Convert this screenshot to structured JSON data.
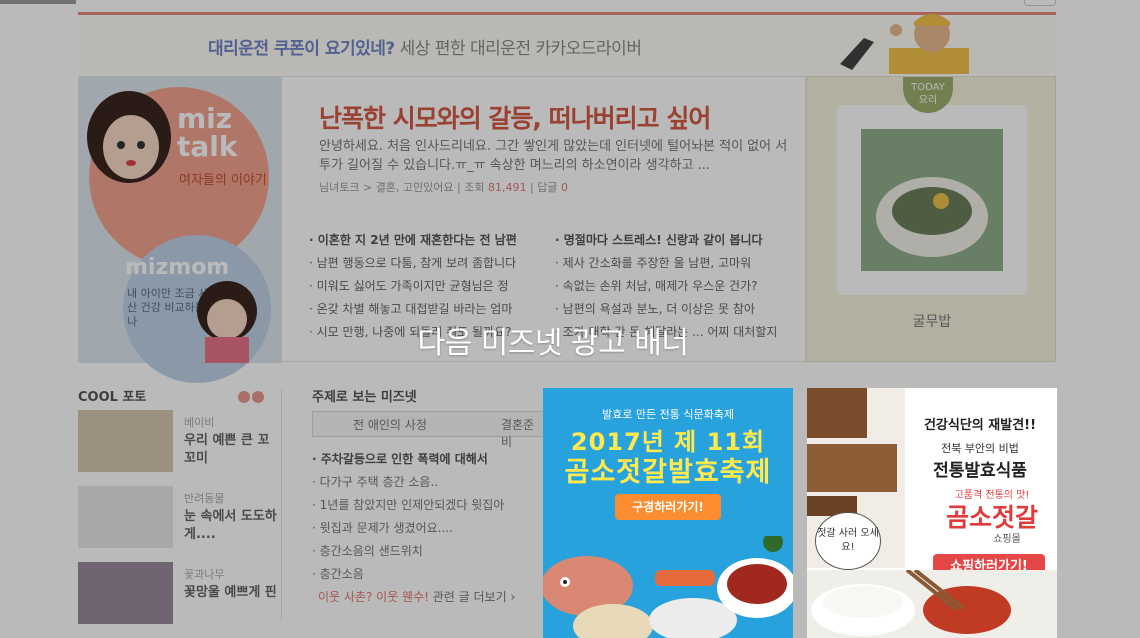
{
  "background_page": {
    "kakao_banner": {
      "highlight": "대리운전 쿠폰이 요기있네?",
      "rest": " 세상 편한 대리운전 카카오드라이버"
    },
    "miztalk": {
      "brand": "miz talk",
      "brand_sub": "여자들의 이야기",
      "mom_brand": "mizmom",
      "mom_sub": "내 아이만 조금 사산 건강 비교하는 나"
    },
    "feature": {
      "title": "난폭한 시모와의 갈등, 떠나버리고 싶어",
      "body": "안녕하세요. 처음 인사드리네요. 그간 쌓인게 많았는데 인터넷에 털어놔본 적이 없어 서투가 길어질 수 있습니다.ㅠ_ㅠ 속상한 며느리의 하소연이라 생각하고 ...",
      "breadcrumb": "님녀토크 > 결혼, 고민있어요",
      "views_label": "조회",
      "views": "81,491",
      "comments_label": "답글",
      "comments": "0"
    },
    "list_left": [
      "이혼한 지 2년 만에 재혼한다는 전 남편",
      "남편 행동으로 다툼, 참게 보려 좀합니다",
      "미워도 싫어도 가족이지만 균형님은 정",
      "온갖 차별 해놓고 대접받길 바라는 엄마",
      "시모 만행, 나중에 되돌려 줘도 될까요?"
    ],
    "list_right": [
      "명절마다 스트레스! 신랑과 같이 봅니다",
      "제사 간소화를 주장한 울 남편, 고마워",
      "속없는 손위 처남, 매제가 우스운 건가?",
      "남편의 욕설과 분노, 더 이상은 못 참아",
      "조카 대학 간 돈 해달라는 ... 어찌 대처할지"
    ],
    "today": {
      "badge_top": "TODAY",
      "badge_bottom": "요리",
      "caption": "굴무밥"
    },
    "cool_photo": {
      "title": "COOL 포토",
      "items": [
        {
          "category": "베이비",
          "text": "우리 예쁜 큰 꼬꼬미"
        },
        {
          "category": "반려동물",
          "text": "눈 속에서 도도하게...."
        },
        {
          "category": "꽃과나무",
          "text": "꽃망울 예쁘게 핀"
        }
      ]
    },
    "topics": {
      "title": "주제로 보는 미즈넷",
      "tabs": [
        "전 애인의 사정",
        "결혼준비"
      ],
      "items": [
        "주차갈등으로 인한 폭력에 대해서",
        "다가구 주택 층간 소음..",
        "1년를 참았지만 인제안되겠다 윗집아",
        "윗집과 문제가 생겼어요....",
        "층간소음의 샌드위치",
        "층간소음"
      ],
      "more_highlight": "이웃 사촌? 이웃 웬수!",
      "more_rest": " 관련 글 더보기 ›"
    }
  },
  "overlay": {
    "title": "다음 미즈넷 광고 배너",
    "ad_left": {
      "subtitle": "발효로 만든 전통 식문화축제",
      "line1": "2017년 제 11회",
      "line2": "곰소젓갈발효축제",
      "button": "구경하러가기!"
    },
    "ad_right": {
      "headline": "건강식단의 재발견!!",
      "sub": "전북 부안의 비법",
      "title": "전통발효식품",
      "tag": "고품격 전통의 맛!",
      "brand": "곰소젓갈",
      "mall": "쇼핑몰",
      "speech": "젓갈 사러 오세요!",
      "button": "쇼핑하러가기!"
    }
  },
  "colors": {
    "overlay": "#000000",
    "accent_red": "#d45a45",
    "ad_blue": "#28a2dd",
    "ad_orange": "#fb8c2f",
    "ad_red": "#e54747"
  }
}
